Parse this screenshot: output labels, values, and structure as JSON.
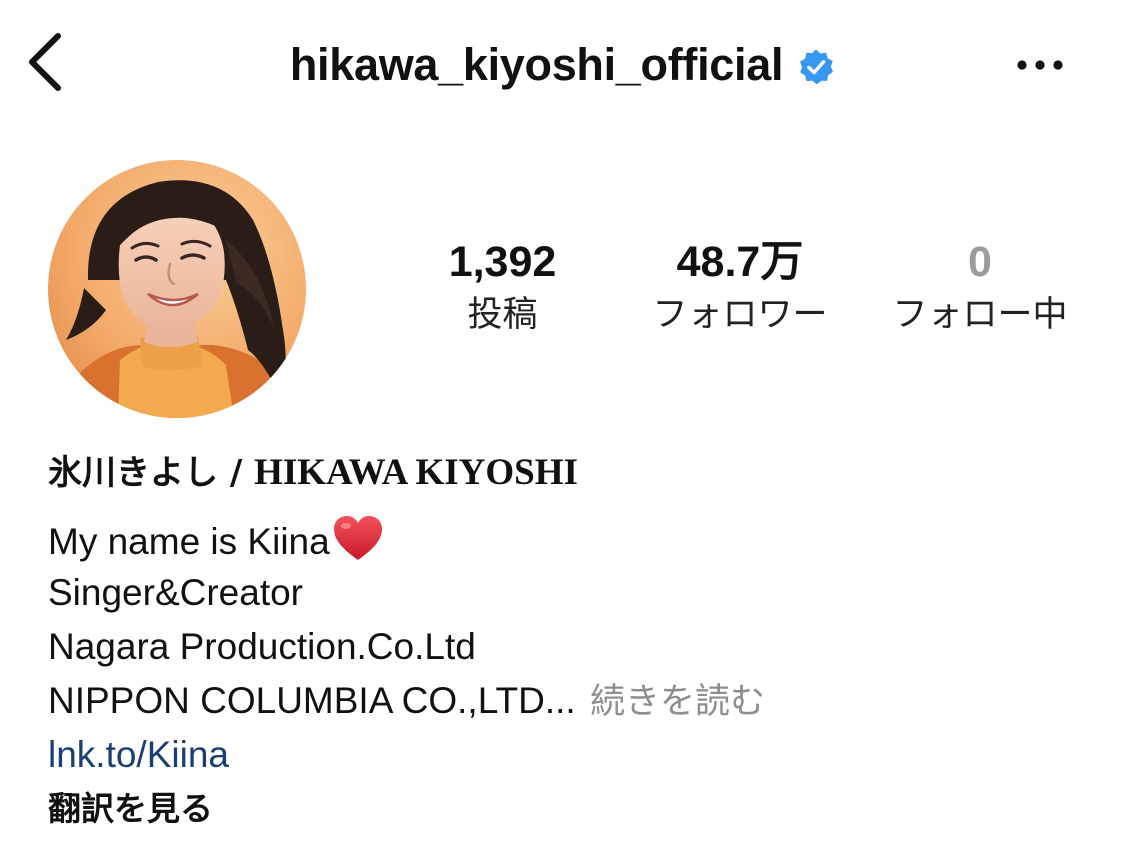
{
  "header": {
    "username": "hikawa_kiyoshi_official",
    "verified": true,
    "back_icon": "chevron-left-icon",
    "verified_icon": "verified-badge-icon",
    "more_icon": "more-horizontal-icon"
  },
  "stats": {
    "posts": {
      "value": "1,392",
      "label": "投稿"
    },
    "followers": {
      "value": "48.7万",
      "label": "フォロワー"
    },
    "following": {
      "value": "0",
      "label": "フォロー中"
    }
  },
  "profile": {
    "name_jp": "氷川きよし / ",
    "name_en": "HIKAWA KIYOSHI",
    "bio": {
      "line1": "My name is Kiina",
      "line1_emoji": "heart-emoji",
      "line2": "Singer&Creator",
      "line3": "Nagara Production.Co.Ltd",
      "line4": "NIPPON COLUMBIA CO.,LTD...",
      "more_label": "続きを読む"
    },
    "link": "lnk.to/Kiina",
    "translate_label": "翻訳を見る"
  },
  "colors": {
    "verified_blue": "#3897f0",
    "link_blue": "#1b3f72",
    "muted_gray": "#8e8e8e",
    "avatar_background": "#f2a766"
  }
}
